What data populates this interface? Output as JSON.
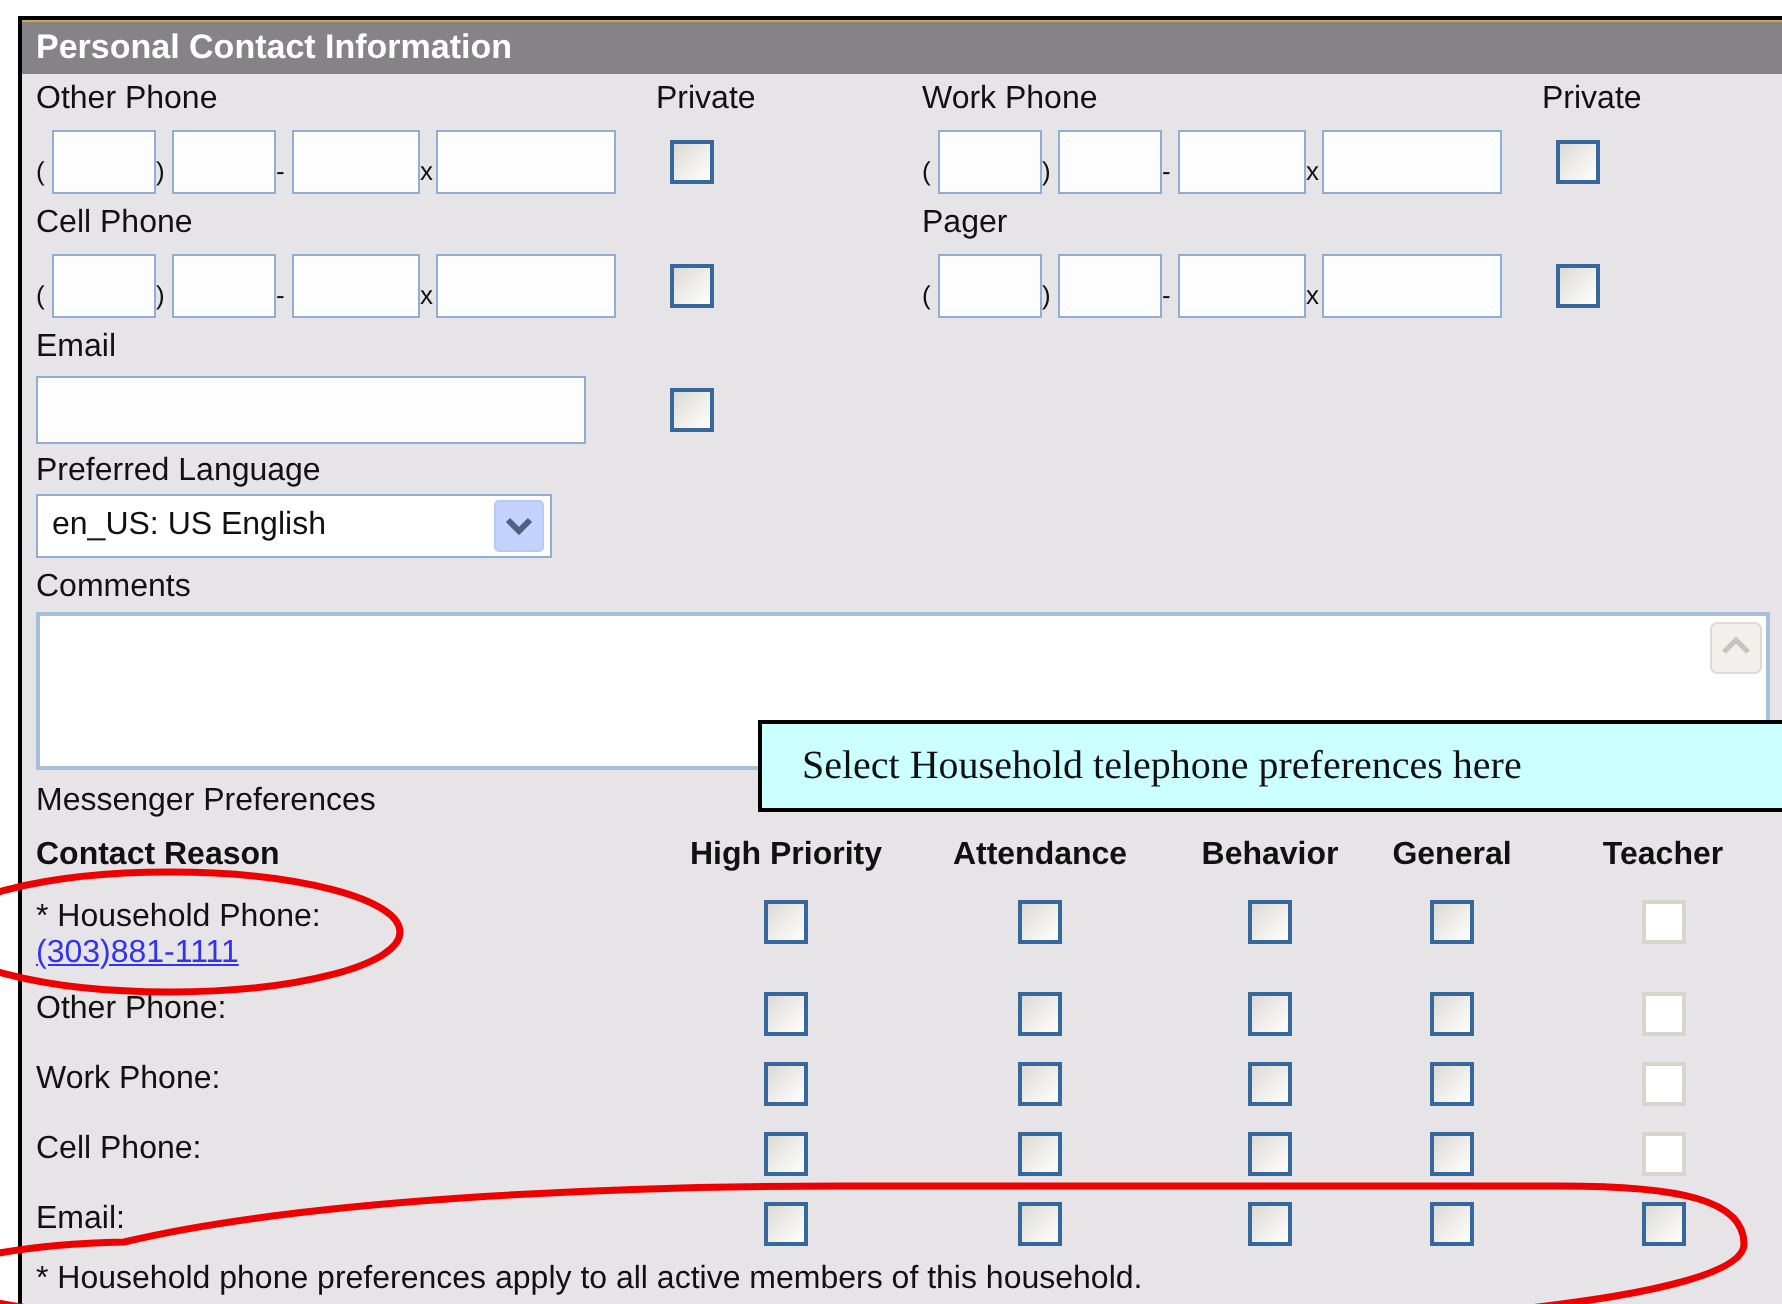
{
  "section": {
    "title": "Personal Contact Information"
  },
  "phones": [
    {
      "label": "Other Phone",
      "private_label": "Private",
      "separators": [
        "(",
        ")",
        "-",
        "x"
      ],
      "private": false
    },
    {
      "label": "Work Phone",
      "private_label": "Private",
      "separators": [
        "(",
        ")",
        "-",
        "x"
      ],
      "private": false
    },
    {
      "label": "Cell Phone",
      "separators": [
        "(",
        ")",
        "-",
        "x"
      ],
      "private": false
    },
    {
      "label": "Pager",
      "separators": [
        "(",
        ")",
        "-",
        "x"
      ],
      "private": false
    }
  ],
  "email": {
    "label": "Email",
    "private": false
  },
  "language": {
    "label": "Preferred Language",
    "value": "en_US: US English"
  },
  "comments": {
    "label": "Comments"
  },
  "messenger": {
    "title": "Messenger Preferences",
    "columns": [
      "Contact Reason",
      "High Priority",
      "Attendance",
      "Behavior",
      "General",
      "Teacher"
    ],
    "rows": [
      {
        "label": "* Household Phone:",
        "link": "(303)881-1111",
        "checks": [
          {
            "checked": false,
            "disabled": false
          },
          {
            "checked": false,
            "disabled": false
          },
          {
            "checked": false,
            "disabled": false
          },
          {
            "checked": false,
            "disabled": false
          },
          {
            "checked": false,
            "disabled": true
          }
        ]
      },
      {
        "label": "Other Phone:",
        "checks": [
          {
            "checked": false,
            "disabled": false
          },
          {
            "checked": false,
            "disabled": false
          },
          {
            "checked": false,
            "disabled": false
          },
          {
            "checked": false,
            "disabled": false
          },
          {
            "checked": false,
            "disabled": true
          }
        ]
      },
      {
        "label": "Work Phone:",
        "checks": [
          {
            "checked": false,
            "disabled": false
          },
          {
            "checked": false,
            "disabled": false
          },
          {
            "checked": false,
            "disabled": false
          },
          {
            "checked": false,
            "disabled": false
          },
          {
            "checked": false,
            "disabled": true
          }
        ]
      },
      {
        "label": "Cell Phone:",
        "checks": [
          {
            "checked": false,
            "disabled": false
          },
          {
            "checked": false,
            "disabled": false
          },
          {
            "checked": false,
            "disabled": false
          },
          {
            "checked": false,
            "disabled": false
          },
          {
            "checked": false,
            "disabled": true
          }
        ]
      },
      {
        "label": "Email:",
        "checks": [
          {
            "checked": false,
            "disabled": false
          },
          {
            "checked": false,
            "disabled": false
          },
          {
            "checked": false,
            "disabled": false
          },
          {
            "checked": false,
            "disabled": false
          },
          {
            "checked": false,
            "disabled": false
          }
        ]
      }
    ],
    "footnote": "* Household phone preferences apply to all active members of this household."
  },
  "callout": {
    "text": "Select Household telephone preferences here"
  }
}
